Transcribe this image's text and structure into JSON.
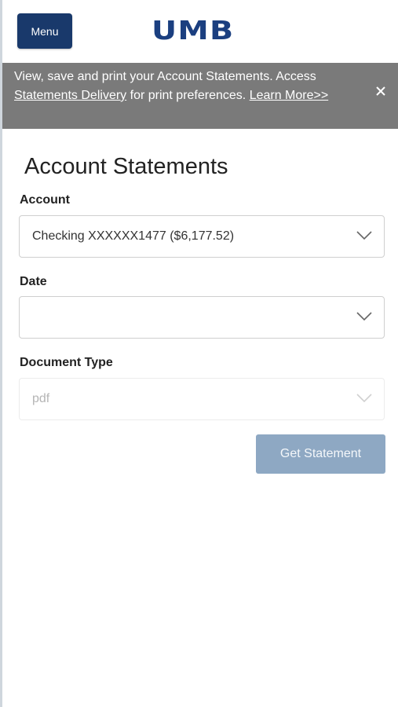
{
  "header": {
    "menu_label": "Menu",
    "logo_text": "UMB",
    "brand_color": "#1b3f80"
  },
  "banner": {
    "text_before_link": "View, save and print your Account Statements. Access ",
    "link1_text": "Statements Delivery",
    "text_middle": " for print preferences. ",
    "link2_text": "Learn More>>",
    "close_icon": "close-icon",
    "background_color": "#7a7a7a"
  },
  "main": {
    "title": "Account Statements",
    "account": {
      "label": "Account",
      "value": "Checking XXXXXX1477 ($6,177.52)"
    },
    "date": {
      "label": "Date",
      "value": ""
    },
    "document_type": {
      "label": "Document Type",
      "value": "pdf"
    },
    "get_statement_label": "Get Statement",
    "button_color": "#8ea8c3"
  }
}
